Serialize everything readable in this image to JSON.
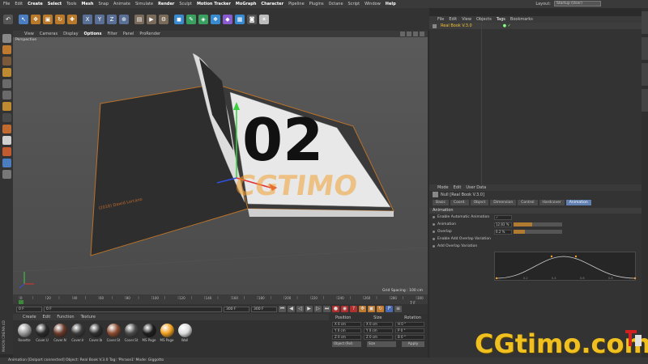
{
  "menu": [
    "File",
    "Edit",
    "Create",
    "Select",
    "Tools",
    "Mesh",
    "Snap",
    "Animate",
    "Simulate",
    "Render",
    "Sculpt",
    "Motion Tracker",
    "MoGraph",
    "Character",
    "Pipeline",
    "Plugins",
    "Octane",
    "Script",
    "Window",
    "Help"
  ],
  "menu_highlight": [
    2,
    3,
    5,
    9,
    11,
    12,
    13,
    19
  ],
  "layout": {
    "label": "Layout:",
    "value": "Startup (User)"
  },
  "viewport": {
    "menu": [
      "View",
      "Cameras",
      "Display",
      "Options",
      "Filter",
      "Panel",
      "ProRender"
    ],
    "active_index": 3,
    "label": "Perspective",
    "grid_spacing": "Grid Spacing : 100 cm",
    "book_text": "(2018) Dawid Lorcano",
    "page_number": "02",
    "watermark": "CGTIMO"
  },
  "timeline": {
    "ticks": [
      "0",
      "10",
      "20",
      "30",
      "40",
      "50",
      "60",
      "70",
      "80",
      "90",
      "100",
      "110",
      "120",
      "130",
      "140",
      "150",
      "160",
      "170",
      "180",
      "190",
      "200",
      "210",
      "220",
      "230",
      "240",
      "250",
      "260",
      "270",
      "280",
      "290",
      "300"
    ],
    "current": "7 F"
  },
  "playbar": {
    "start": "0 F",
    "start2": "0 F",
    "end": "300 F",
    "end2": "300 F"
  },
  "materials": {
    "menu": [
      "Create",
      "Edit",
      "Function",
      "Texture"
    ],
    "items": [
      {
        "name": "Rosette",
        "color": "#9a9a9a"
      },
      {
        "name": "Cover.U",
        "color": "#2a2a2a"
      },
      {
        "name": "Cover.N",
        "color": "#6a3a2a"
      },
      {
        "name": "Cover.Ir",
        "color": "#3a3a3a"
      },
      {
        "name": "Cover.Ib",
        "color": "#2e2e2e"
      },
      {
        "name": "Cover.St",
        "color": "#8a4a30"
      },
      {
        "name": "Cover.St",
        "color": "#4a4a4a"
      },
      {
        "name": "MS Page",
        "color": "#1e1e1e"
      },
      {
        "name": "MS Page",
        "color": "#f0a020"
      },
      {
        "name": "Wall",
        "color": "#dddddd"
      }
    ]
  },
  "coords": {
    "headers": [
      "Position",
      "Size",
      "Rotation"
    ],
    "rows": [
      [
        "X  0 cm",
        "X  0 cm",
        "H  0 °"
      ],
      [
        "Y  0 cm",
        "Y  0 cm",
        "P  0 °"
      ],
      [
        "Z  0 cm",
        "Z  0 cm",
        "B  0 °"
      ]
    ],
    "mode": "Object (Rel)",
    "size_mode": "Size",
    "apply": "Apply"
  },
  "status": "Animation [Dolport connected] Object: Real Book V.3.0  Tag: 'Phrase1' Mode: Giggotto",
  "objects": {
    "menu": [
      "File",
      "Edit",
      "View",
      "Objects",
      "Tags",
      "Bookmarks"
    ],
    "active_index": 4,
    "row": "Real Book V.3.0"
  },
  "attributes": {
    "menu": [
      "Mode",
      "Edit",
      "User Data"
    ],
    "title": "Null [Real Book V.3.0]",
    "tabs": [
      "Basic",
      "Coord.",
      "Object",
      "Dimension",
      "Control",
      "Hardcover",
      "Animation"
    ],
    "active_tab": 6,
    "section": "Animation",
    "props": [
      {
        "label": "Enable Automatic Animation",
        "value": "✓"
      },
      {
        "label": "Animation",
        "value": "12.83 %",
        "fill": 0.1283
      },
      {
        "label": "Overlap",
        "value": "6.2 %",
        "fill": 0.062
      },
      {
        "label": "Enable Add Overlap Variation",
        "value": ""
      },
      {
        "label": "Add Overlap Variation",
        "value": ""
      }
    ],
    "curve_ticks": [
      "0.2",
      "0.4",
      "0.6",
      "0.8"
    ]
  },
  "watermark_brand": "CGtimo.com",
  "maxon": "MAXON CINEMA 4D"
}
